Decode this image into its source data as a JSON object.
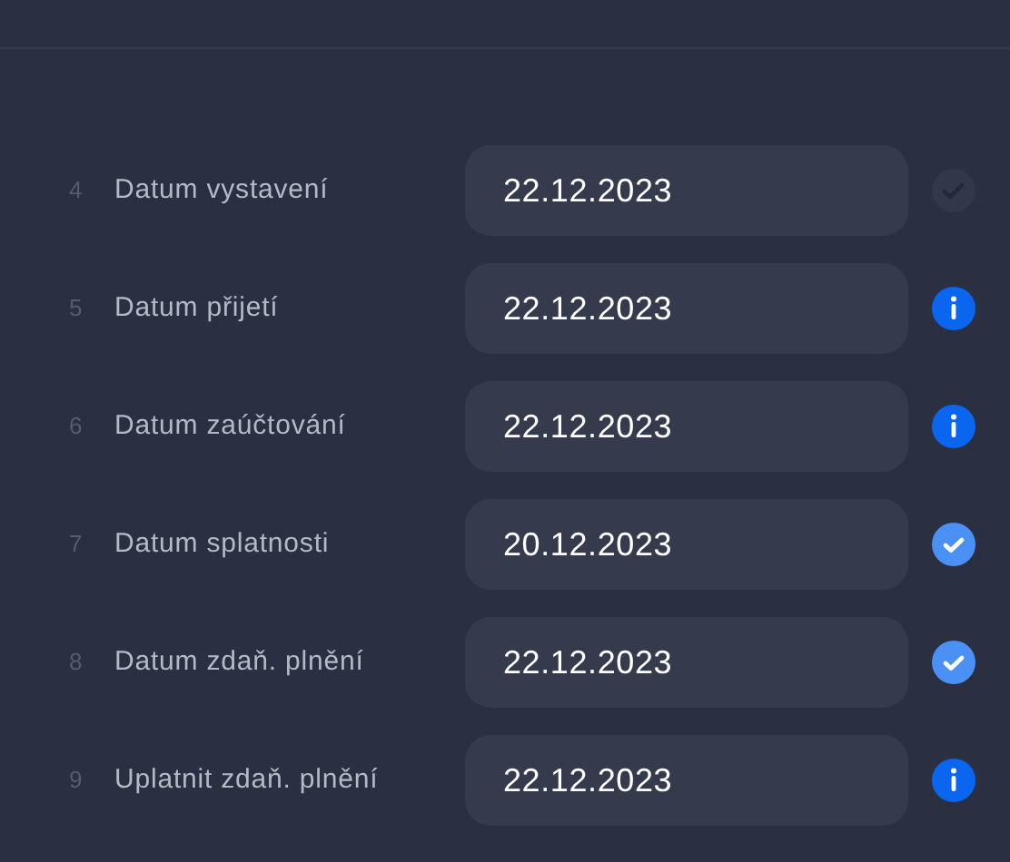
{
  "rows": [
    {
      "number": "4",
      "label": "Datum vystavení",
      "value": "22.12.2023",
      "kind": "pending"
    },
    {
      "number": "5",
      "label": "Datum přijetí",
      "value": "22.12.2023",
      "kind": "info"
    },
    {
      "number": "6",
      "label": "Datum zaúčtování",
      "value": "22.12.2023",
      "kind": "info"
    },
    {
      "number": "7",
      "label": "Datum splatnosti",
      "value": "20.12.2023",
      "kind": "ok"
    },
    {
      "number": "8",
      "label": "Datum zdaň. plnění",
      "value": "22.12.2023",
      "kind": "ok"
    },
    {
      "number": "9",
      "label": "Uplatnit zdaň. plnění",
      "value": "22.12.2023",
      "kind": "info"
    }
  ]
}
